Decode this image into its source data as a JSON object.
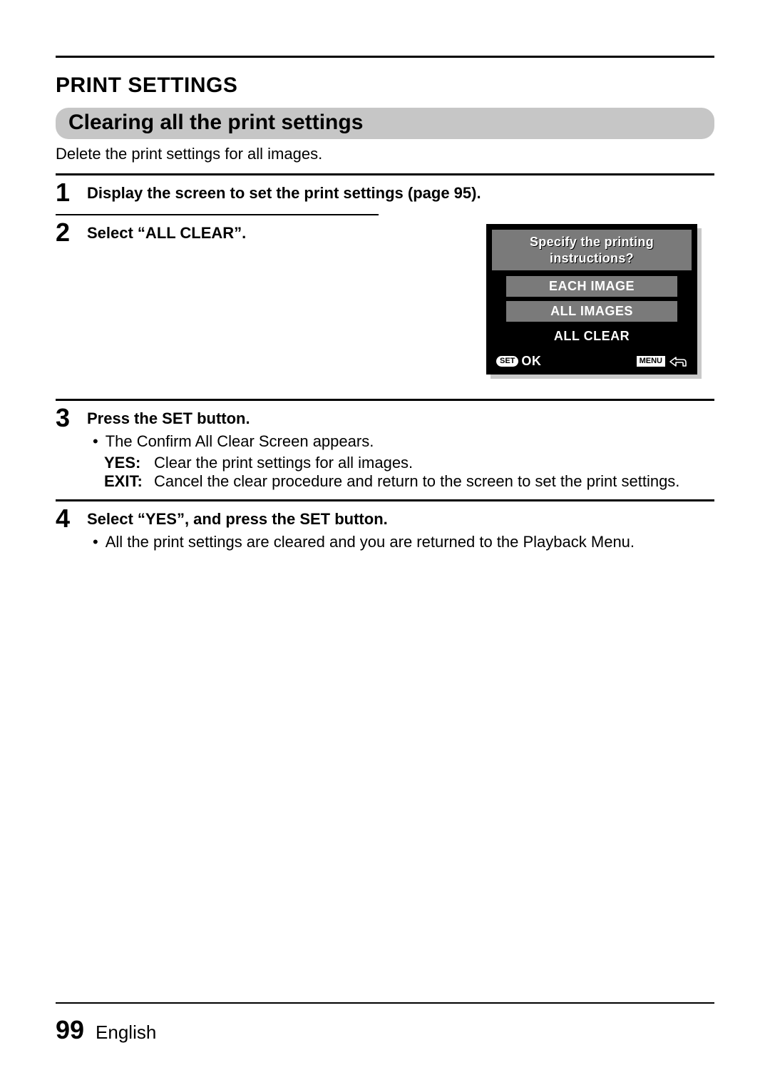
{
  "header": {
    "section_title": "PRINT SETTINGS",
    "subsection_title": "Clearing all the print settings",
    "intro": "Delete the print settings for all images."
  },
  "steps": {
    "s1": {
      "num": "1",
      "title": "Display the screen to set the print settings (page 95)."
    },
    "s2": {
      "num": "2",
      "title": "Select “ALL CLEAR”."
    },
    "s3": {
      "num": "3",
      "title": "Press the SET button.",
      "bullet": "The Confirm All Clear Screen appears.",
      "options": {
        "yes_key": "YES:",
        "yes_val": "Clear the print settings for all images.",
        "exit_key": "EXIT:",
        "exit_val": "Cancel the clear procedure and return to the screen to set the print settings."
      }
    },
    "s4": {
      "num": "4",
      "title": "Select “YES”, and press the SET button.",
      "bullet": "All the print settings are cleared and you are returned to the Playback Menu."
    }
  },
  "lcd": {
    "header_line1": "Specify the printing",
    "header_line2": "instructions?",
    "opt1": "EACH IMAGE",
    "opt2": "ALL IMAGES",
    "opt3": "ALL CLEAR",
    "set_label": "SET",
    "ok_label": "OK",
    "menu_label": "MENU"
  },
  "footer": {
    "page_number": "99",
    "language": "English"
  }
}
